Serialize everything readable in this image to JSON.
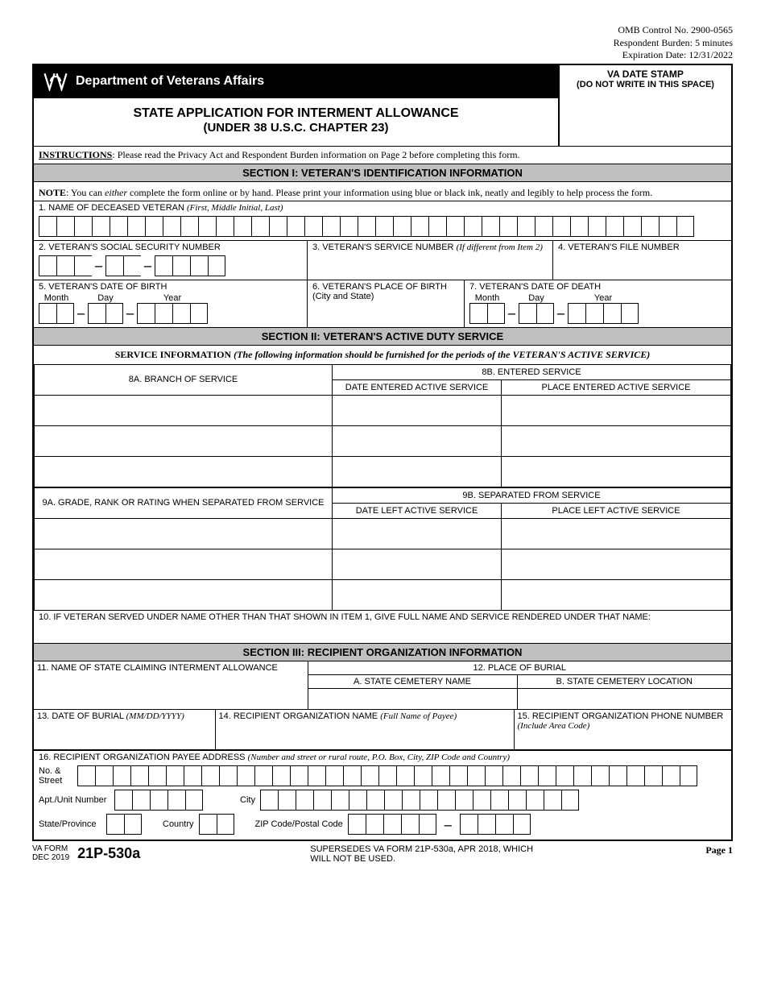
{
  "omb": {
    "control": "OMB Control No. 2900-0565",
    "burden": "Respondent Burden: 5 minutes",
    "expiration": "Expiration Date: 12/31/2022"
  },
  "header": {
    "department": "Department of Veterans Affairs",
    "date_stamp_1": "VA DATE STAMP",
    "date_stamp_2": "(DO NOT WRITE IN THIS SPACE)",
    "title_1": "STATE APPLICATION FOR INTERMENT ALLOWANCE",
    "title_2": "(UNDER 38 U.S.C. CHAPTER 23)"
  },
  "instructions": {
    "label": "INSTRUCTIONS",
    "text": ": Please read the Privacy Act and Respondent Burden information on Page 2 before completing this form."
  },
  "section1": {
    "header": "SECTION I: VETERAN'S IDENTIFICATION INFORMATION",
    "note_prefix": "NOTE",
    "note_mid1": ": You can ",
    "note_em": "either",
    "note_mid2": " complete the form online or by hand. Please print your information using blue or black ink, neatly and legibly to help process the form.",
    "f1": "1. NAME OF DECEASED VETERAN ",
    "f1_italic": "(First, Middle Initial, Last)",
    "f2": "2. VETERAN'S SOCIAL SECURITY NUMBER",
    "f3": "3. VETERAN'S SERVICE NUMBER ",
    "f3_italic": "(If different from Item 2)",
    "f4": "4. VETERAN'S FILE NUMBER",
    "f5": "5. VETERAN'S DATE OF BIRTH",
    "f6": "6. VETERAN'S PLACE OF BIRTH (City and State)",
    "f7": "7. VETERAN'S DATE OF DEATH",
    "month": "Month",
    "day": "Day",
    "year": "Year"
  },
  "section2": {
    "header": "SECTION II: VETERAN'S ACTIVE DUTY SERVICE",
    "service_info_label": "SERVICE INFORMATION ",
    "service_info_italic": "(The following information should be furnished for the periods of the VETERAN'S ACTIVE SERVICE)",
    "c8a": "8A. BRANCH OF SERVICE",
    "c8b": "8B. ENTERED SERVICE",
    "c8b_date": "DATE ENTERED ACTIVE SERVICE",
    "c8b_place": "PLACE ENTERED ACTIVE SERVICE",
    "c9a": "9A. GRADE, RANK OR RATING WHEN SEPARATED FROM SERVICE",
    "c9b": "9B. SEPARATED FROM SERVICE",
    "c9b_date": "DATE LEFT ACTIVE SERVICE",
    "c9b_place": "PLACE LEFT ACTIVE SERVICE",
    "f10": "10. IF VETERAN SERVED UNDER NAME OTHER THAN THAT SHOWN IN ITEM 1, GIVE FULL NAME AND SERVICE RENDERED UNDER THAT NAME:"
  },
  "section3": {
    "header": "SECTION III: RECIPIENT ORGANIZATION INFORMATION",
    "f11": "11. NAME OF STATE CLAIMING INTERMENT ALLOWANCE",
    "f12": "12. PLACE OF BURIAL",
    "f12a": "A. STATE CEMETERY NAME",
    "f12b": "B. STATE CEMETERY LOCATION",
    "f13": "13. DATE OF BURIAL ",
    "f13_italic": "(MM/DD/YYYY)",
    "f14": "14. RECIPIENT ORGANIZATION NAME ",
    "f14_italic": "(Full Name of Payee)",
    "f15": "15. RECIPIENT ORGANIZATION PHONE NUMBER ",
    "f15_italic": "(Include Area Code)",
    "f16": "16. RECIPIENT ORGANIZATION PAYEE ADDRESS ",
    "f16_italic": "(Number and street or rural route, P.O. Box, City, ZIP Code and Country)",
    "addr_no_street": "No. & Street",
    "addr_apt": "Apt./Unit Number",
    "addr_city": "City",
    "addr_state": "State/Province",
    "addr_country": "Country",
    "addr_zip": "ZIP Code/Postal Code"
  },
  "footer": {
    "va_form": "VA FORM",
    "date": "DEC 2019",
    "number": "21P-530a",
    "supersedes": "SUPERSEDES VA FORM 21P-530a, APR 2018, WHICH WILL NOT BE USED.",
    "page": "Page 1"
  }
}
